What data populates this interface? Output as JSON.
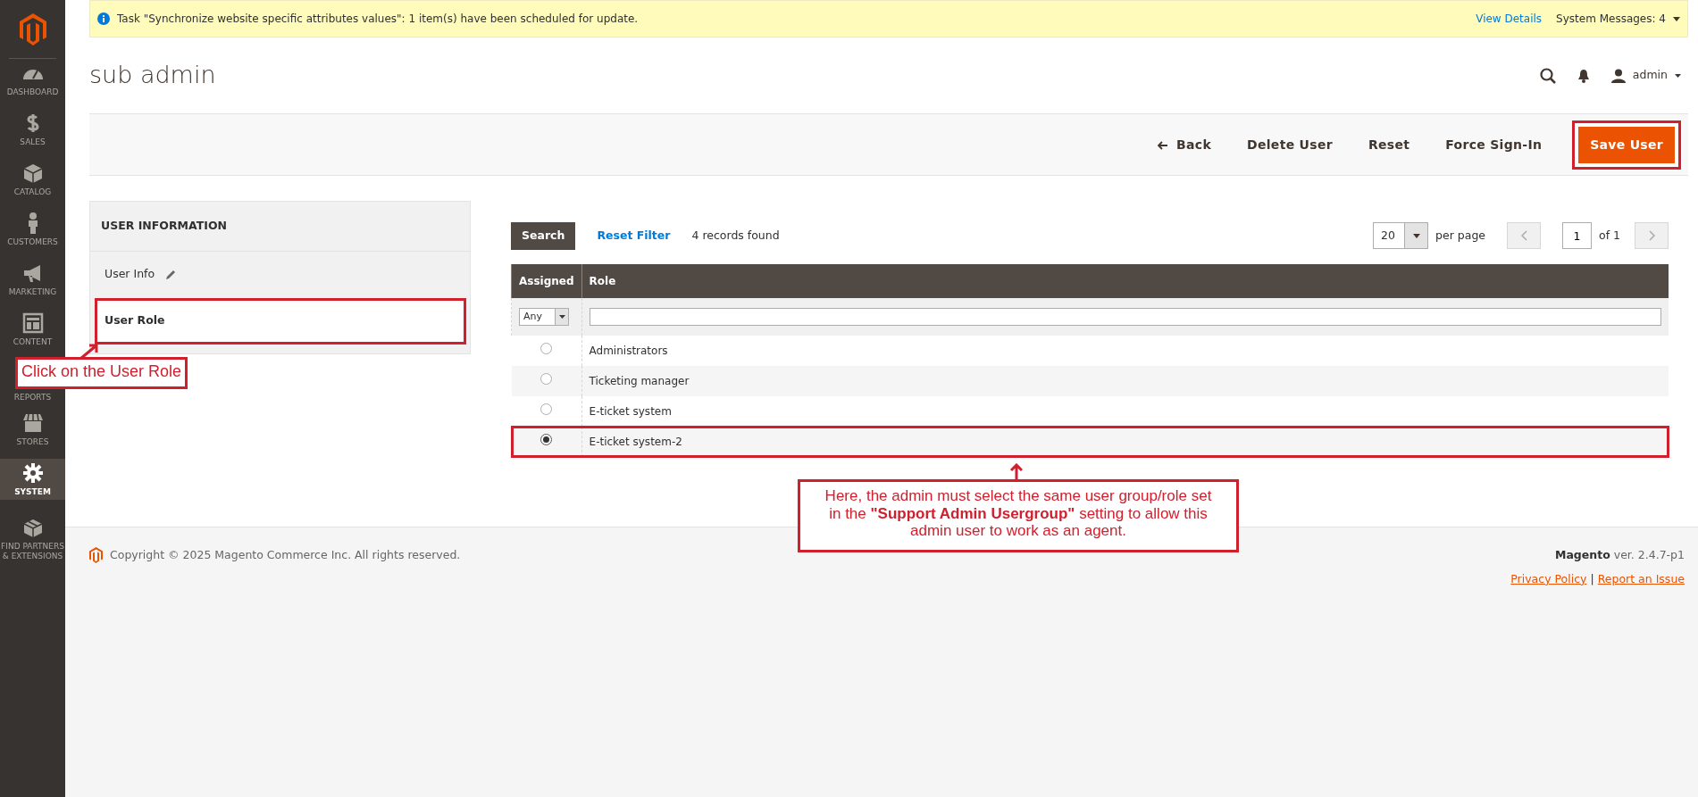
{
  "sidebar": {
    "items": [
      {
        "label": "DASHBOARD",
        "kind": "dashboard",
        "selected": false
      },
      {
        "label": "SALES",
        "kind": "sales",
        "selected": false
      },
      {
        "label": "CATALOG",
        "kind": "catalog",
        "selected": false
      },
      {
        "label": "CUSTOMERS",
        "kind": "customers",
        "selected": false
      },
      {
        "label": "MARKETING",
        "kind": "marketing",
        "selected": false
      },
      {
        "label": "CONTENT",
        "kind": "content",
        "selected": false
      },
      {
        "label": "REPORTS",
        "kind": "reports",
        "selected": false
      },
      {
        "label": "STORES",
        "kind": "stores",
        "selected": false
      },
      {
        "label": "SYSTEM",
        "kind": "system",
        "selected": true
      },
      {
        "label": "FIND PARTNERS & EXTENSIONS",
        "kind": "partners",
        "selected": false
      }
    ]
  },
  "notice": {
    "text": "Task \"Synchronize website specific attributes values\": 1 item(s) have been scheduled for update.",
    "link": "View Details",
    "messages": "System Messages: 4"
  },
  "page_title": "sub admin",
  "header": {
    "user": "admin"
  },
  "toolbar": {
    "buttons": [
      {
        "label": "Back",
        "kind": "back",
        "highlighted": false
      },
      {
        "label": "Delete User",
        "kind": "plain",
        "highlighted": false
      },
      {
        "label": "Reset",
        "kind": "plain",
        "highlighted": false
      },
      {
        "label": "Force Sign-In",
        "kind": "plain",
        "highlighted": false
      },
      {
        "label": "Save User",
        "kind": "primary",
        "highlighted": true
      }
    ]
  },
  "user_panel": {
    "title": "USER INFORMATION",
    "tabs": [
      {
        "label": "User Info",
        "selected": false,
        "highlighted": false,
        "edited": true
      },
      {
        "label": "User Role",
        "selected": true,
        "highlighted": true,
        "edited": false
      }
    ]
  },
  "grid": {
    "search": "Search",
    "reset_filter": "Reset Filter",
    "count": "4 records found",
    "per_page": "20",
    "per_page_label": "per page",
    "page": "1",
    "page_of": "of 1",
    "columns": [
      "Assigned",
      "Role"
    ],
    "filter_assigned": "Any",
    "rows": [
      {
        "role": "Administrators",
        "selected": false,
        "highlighted": false
      },
      {
        "role": "Ticketing manager",
        "selected": false,
        "highlighted": false
      },
      {
        "role": "E-ticket system",
        "selected": false,
        "highlighted": false
      },
      {
        "role": "E-ticket system-2",
        "selected": true,
        "highlighted": true
      }
    ]
  },
  "footer": {
    "copyright": "Copyright © 2025 Magento Commerce Inc. All rights reserved.",
    "brand": "Magento",
    "version": "ver. 2.4.7-p1",
    "links": [
      "Privacy Policy",
      "Report an Issue"
    ],
    "separator": "|"
  },
  "annotations": [
    {
      "kind": "tab-callout",
      "text": "Click on the User Role"
    },
    {
      "kind": "row-callout",
      "text": "Here, the admin must select the same user group/role set in the **\"Support Admin Usergroup\"** setting to allow this admin user to work as an agent."
    }
  ]
}
